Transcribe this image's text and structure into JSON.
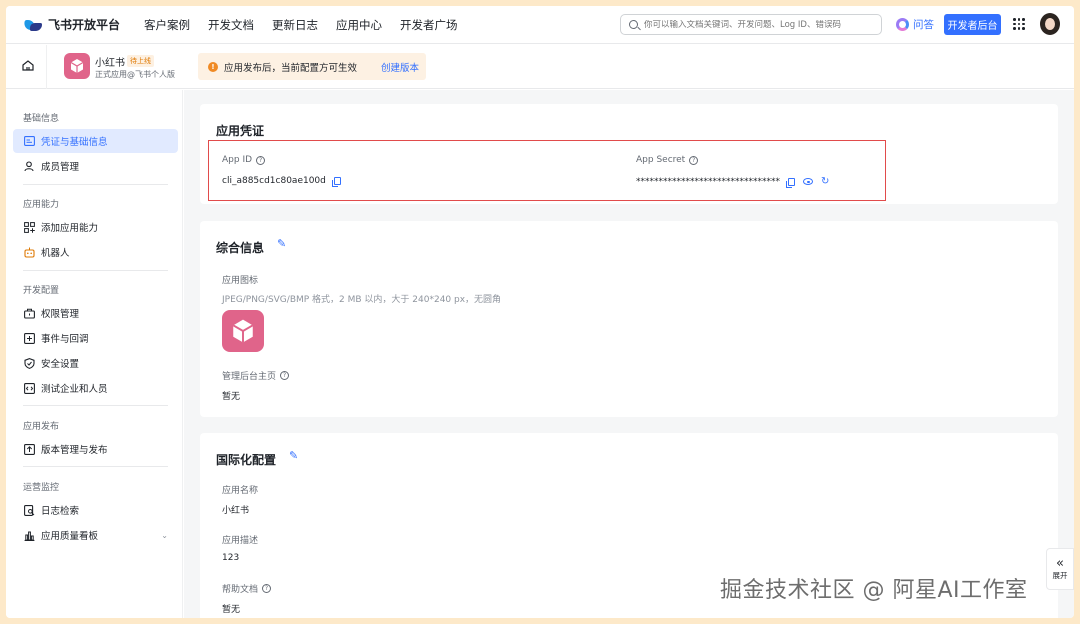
{
  "brand": {
    "name": "飞书开放平台"
  },
  "topnav": {
    "items": [
      "客户案例",
      "开发文档",
      "更新日志",
      "应用中心",
      "开发者广场"
    ],
    "search_placeholder": "你可以输入文档关键词、开发问题、Log ID、错误码",
    "ask_label": "问答",
    "console_label": "开发者后台"
  },
  "app": {
    "name": "小红书",
    "status_tag": "待上线",
    "subtitle": "正式应用@飞书个人版"
  },
  "notice": {
    "text": "应用发布后，当前配置方可生效",
    "link": "创建版本"
  },
  "sidebar": {
    "sections": [
      {
        "title": "基础信息",
        "items": [
          "凭证与基础信息",
          "成员管理"
        ]
      },
      {
        "title": "应用能力",
        "items": [
          "添加应用能力",
          "机器人"
        ]
      },
      {
        "title": "开发配置",
        "items": [
          "权限管理",
          "事件与回调",
          "安全设置",
          "测试企业和人员"
        ]
      },
      {
        "title": "应用发布",
        "items": [
          "版本管理与发布"
        ]
      },
      {
        "title": "运营监控",
        "items": [
          "日志检索",
          "应用质量看板"
        ]
      }
    ]
  },
  "credentials": {
    "title": "应用凭证",
    "app_id_label": "App ID",
    "app_id_value": "cli_a885cd1c80ae100d",
    "app_secret_label": "App Secret",
    "app_secret_value": "********************************"
  },
  "general": {
    "title": "综合信息",
    "icon_label": "应用图标",
    "icon_hint": "JPEG/PNG/SVG/BMP 格式，2 MB 以内，大于 240*240 px，无圆角",
    "homepage_label": "管理后台主页",
    "homepage_value": "暂无"
  },
  "i18n": {
    "title": "国际化配置",
    "name_label": "应用名称",
    "name_value": "小红书",
    "desc_label": "应用描述",
    "desc_value": "123",
    "help_label": "帮助文档",
    "help_value": "暂无"
  },
  "collapse": {
    "label": "展开"
  },
  "watermark": "掘金技术社区 @ 阿星AI工作室",
  "colors": {
    "accent": "#3370ff",
    "app_icon": "#e0648a",
    "highlight": "#e14b4b"
  }
}
